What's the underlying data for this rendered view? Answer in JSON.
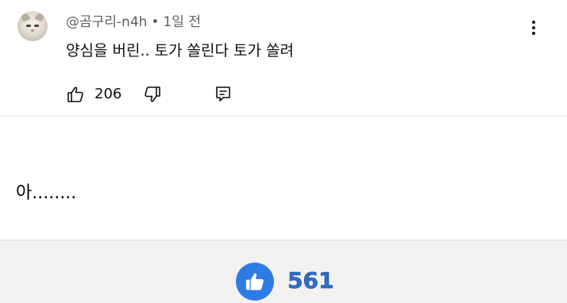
{
  "comment": {
    "author": "@곰구리-n4h",
    "separator": "•",
    "time": "1일 전",
    "text": "양심을 버린.. 토가 쏠린다 토가 쏠려",
    "like_count": "206",
    "avatar_icon": "cat-avatar",
    "more_icon": "more-vertical-icon"
  },
  "icons": {
    "like": "thumbs-up-icon",
    "dislike": "thumbs-down-icon",
    "reply": "reply-icon"
  },
  "caption": {
    "text": "아........"
  },
  "reaction_bar": {
    "like_count": "561",
    "icon_color": "#2f7be4",
    "count_color": "#2f6dc9"
  }
}
